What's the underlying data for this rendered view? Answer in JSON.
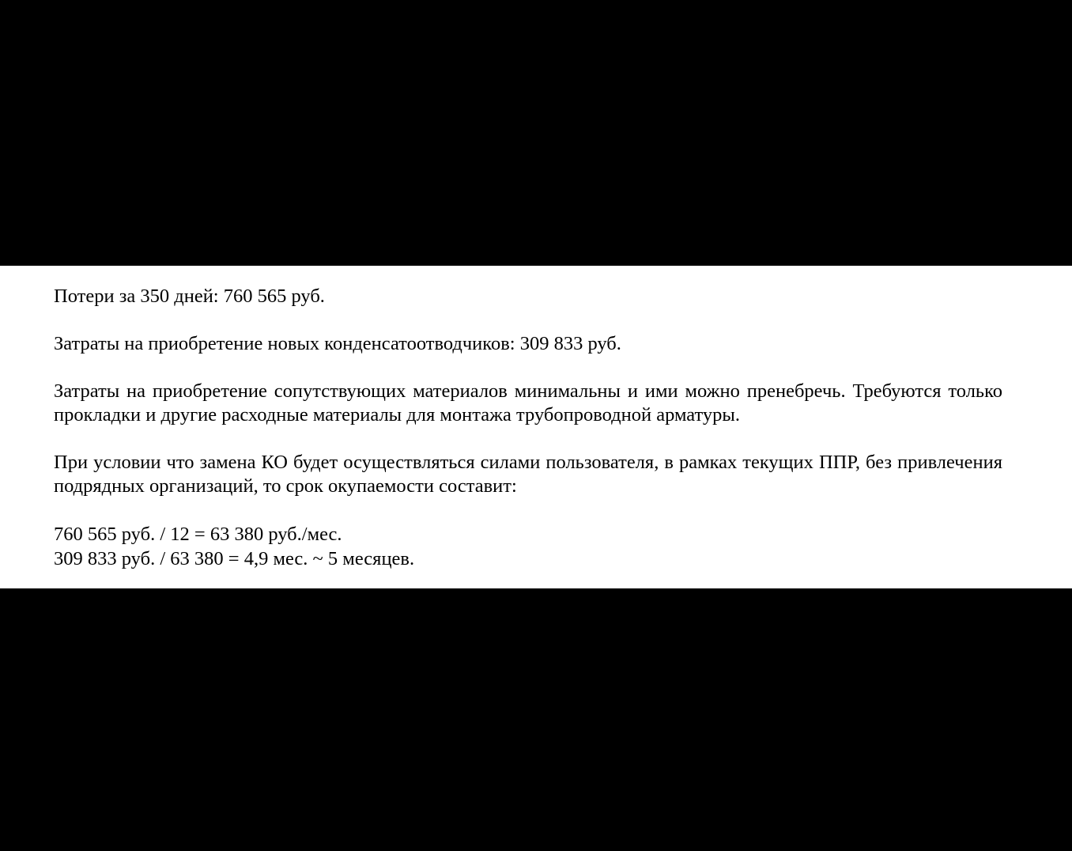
{
  "document": {
    "paragraphs": [
      "Потери за 350 дней: 760 565 руб.",
      "Затраты на приобретение новых конденсатоотводчиков: 309 833 руб.",
      "Затраты на приобретение сопутствующих материалов минимальны и ими можно пренебречь. Требуются только прокладки и другие расходные материалы для монтажа трубопроводной арматуры.",
      "При условии что замена КО будет осуществляться силами пользователя, в рамках текущих ППР, без привлечения подрядных организаций, то срок окупаемости составит:"
    ],
    "calculations": [
      "760 565 руб. / 12 = 63 380 руб./мес.",
      "309 833 руб. / 63 380 = 4,9 мес. ~ 5 месяцев."
    ]
  },
  "colors": {
    "background": "#000000",
    "page": "#ffffff",
    "text": "#000000"
  }
}
